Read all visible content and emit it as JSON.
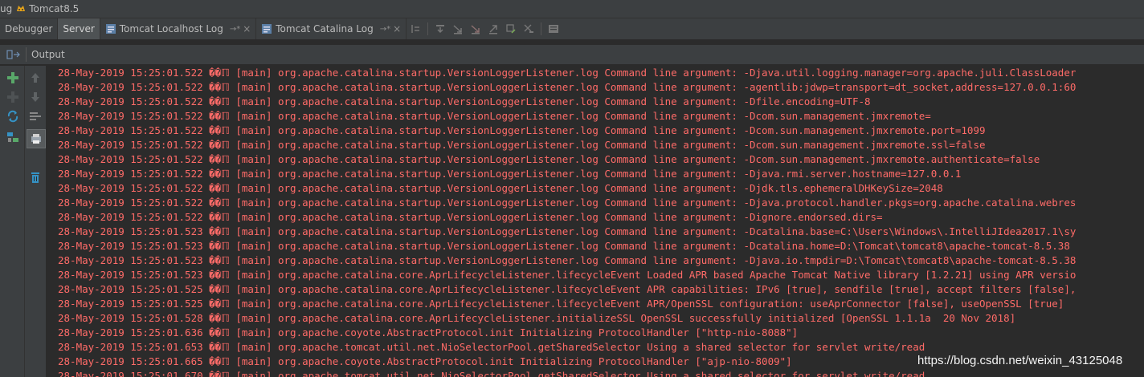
{
  "title_bar": {
    "left_fragment": "ug",
    "config_name": "Tomcat8.5"
  },
  "tabs": [
    {
      "label": "Debugger",
      "active": false
    },
    {
      "label": "Server",
      "active": true
    },
    {
      "label": "Tomcat Localhost Log",
      "pin": "→*",
      "close": "×"
    },
    {
      "label": "Tomcat Catalina Log",
      "pin": "→*",
      "close": "×"
    }
  ],
  "toolbar_icons": [
    "show-execution-point-icon",
    "step-over-icon",
    "step-into-icon",
    "force-step-into-icon",
    "step-out-icon",
    "drop-frame-icon",
    "run-to-cursor-icon",
    "evaluate-icon"
  ],
  "output_header": {
    "label": "Output"
  },
  "gutter_icons": [
    "add-icon",
    "up-arrow-icon",
    "remove-icon",
    "down-arrow-icon",
    "refresh-icon",
    "wrap-icon",
    "soft-wrap-icon",
    "print-icon",
    "trash-icon"
  ],
  "console": {
    "text_color": "#ff6b68",
    "lines": [
      "28-May-2019 15:25:01.522 ��ℿ [main] org.apache.catalina.startup.VersionLoggerListener.log Command line argument: -Djava.util.logging.manager=org.apache.juli.ClassLoader",
      "28-May-2019 15:25:01.522 ��ℿ [main] org.apache.catalina.startup.VersionLoggerListener.log Command line argument: -agentlib:jdwp=transport=dt_socket,address=127.0.0.1:60",
      "28-May-2019 15:25:01.522 ��ℿ [main] org.apache.catalina.startup.VersionLoggerListener.log Command line argument: -Dfile.encoding=UTF-8",
      "28-May-2019 15:25:01.522 ��ℿ [main] org.apache.catalina.startup.VersionLoggerListener.log Command line argument: -Dcom.sun.management.jmxremote=",
      "28-May-2019 15:25:01.522 ��ℿ [main] org.apache.catalina.startup.VersionLoggerListener.log Command line argument: -Dcom.sun.management.jmxremote.port=1099",
      "28-May-2019 15:25:01.522 ��ℿ [main] org.apache.catalina.startup.VersionLoggerListener.log Command line argument: -Dcom.sun.management.jmxremote.ssl=false",
      "28-May-2019 15:25:01.522 ��ℿ [main] org.apache.catalina.startup.VersionLoggerListener.log Command line argument: -Dcom.sun.management.jmxremote.authenticate=false",
      "28-May-2019 15:25:01.522 ��ℿ [main] org.apache.catalina.startup.VersionLoggerListener.log Command line argument: -Djava.rmi.server.hostname=127.0.0.1",
      "28-May-2019 15:25:01.522 ��ℿ [main] org.apache.catalina.startup.VersionLoggerListener.log Command line argument: -Djdk.tls.ephemeralDHKeySize=2048",
      "28-May-2019 15:25:01.522 ��ℿ [main] org.apache.catalina.startup.VersionLoggerListener.log Command line argument: -Djava.protocol.handler.pkgs=org.apache.catalina.webres",
      "28-May-2019 15:25:01.522 ��ℿ [main] org.apache.catalina.startup.VersionLoggerListener.log Command line argument: -Dignore.endorsed.dirs=",
      "28-May-2019 15:25:01.523 ��ℿ [main] org.apache.catalina.startup.VersionLoggerListener.log Command line argument: -Dcatalina.base=C:\\Users\\Windows\\.IntelliJIdea2017.1\\sy",
      "28-May-2019 15:25:01.523 ��ℿ [main] org.apache.catalina.startup.VersionLoggerListener.log Command line argument: -Dcatalina.home=D:\\Tomcat\\tomcat8\\apache-tomcat-8.5.38",
      "28-May-2019 15:25:01.523 ��ℿ [main] org.apache.catalina.startup.VersionLoggerListener.log Command line argument: -Djava.io.tmpdir=D:\\Tomcat\\tomcat8\\apache-tomcat-8.5.38",
      "28-May-2019 15:25:01.523 ��ℿ [main] org.apache.catalina.core.AprLifecycleListener.lifecycleEvent Loaded APR based Apache Tomcat Native library [1.2.21] using APR versio",
      "28-May-2019 15:25:01.525 ��ℿ [main] org.apache.catalina.core.AprLifecycleListener.lifecycleEvent APR capabilities: IPv6 [true], sendfile [true], accept filters [false],",
      "28-May-2019 15:25:01.525 ��ℿ [main] org.apache.catalina.core.AprLifecycleListener.lifecycleEvent APR/OpenSSL configuration: useAprConnector [false], useOpenSSL [true]",
      "28-May-2019 15:25:01.528 ��ℿ [main] org.apache.catalina.core.AprLifecycleListener.initializeSSL OpenSSL successfully initialized [OpenSSL 1.1.1a  20 Nov 2018]",
      "28-May-2019 15:25:01.636 ��ℿ [main] org.apache.coyote.AbstractProtocol.init Initializing ProtocolHandler [\"http-nio-8088\"]",
      "28-May-2019 15:25:01.653 ��ℿ [main] org.apache.tomcat.util.net.NioSelectorPool.getSharedSelector Using a shared selector for servlet write/read",
      "28-May-2019 15:25:01.665 ��ℿ [main] org.apache.coyote.AbstractProtocol.init Initializing ProtocolHandler [\"ajp-nio-8009\"]",
      "28-May-2019 15:25:01.670 ��ℿ [main] org.apache.tomcat.util.net.NioSelectorPool.getSharedSelector Using a shared selector for servlet write/read"
    ]
  },
  "watermark": "https://blog.csdn.net/weixin_43125048"
}
